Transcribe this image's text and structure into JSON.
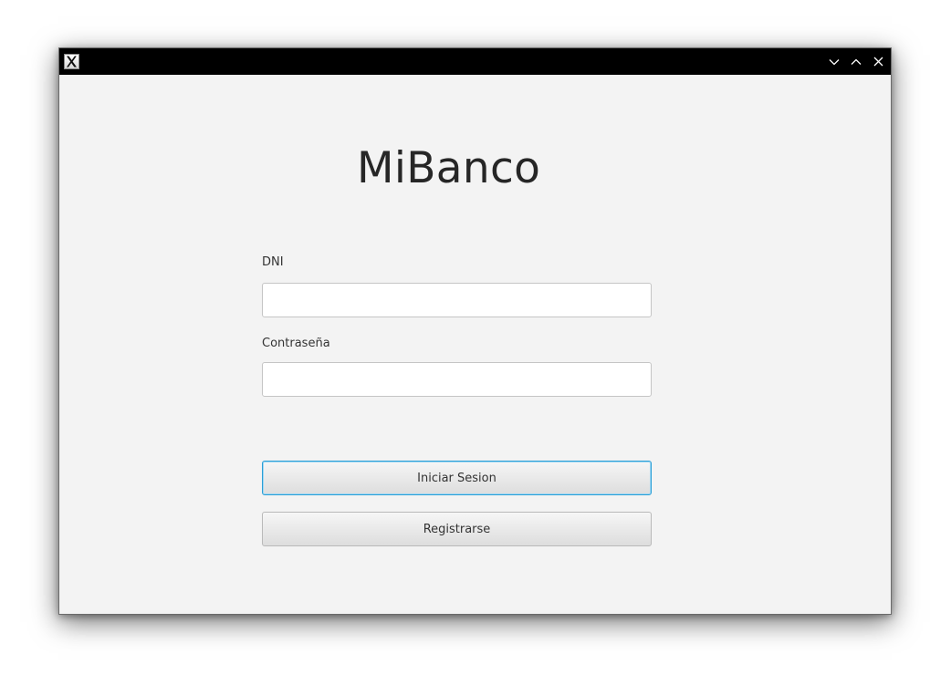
{
  "window": {
    "controls": {
      "minimize_icon": "chevron-down-icon",
      "maximize_icon": "chevron-up-icon",
      "close_icon": "close-icon"
    }
  },
  "app": {
    "title": "MiBanco"
  },
  "form": {
    "dni_label": "DNI",
    "dni_value": "",
    "password_label": "Contraseña",
    "password_value": "",
    "login_button": "Iniciar Sesion",
    "register_button": "Registrarse"
  },
  "colors": {
    "titlebar": "#000000",
    "window_bg": "#f3f3f3",
    "focus_accent": "#2a9fd6"
  }
}
